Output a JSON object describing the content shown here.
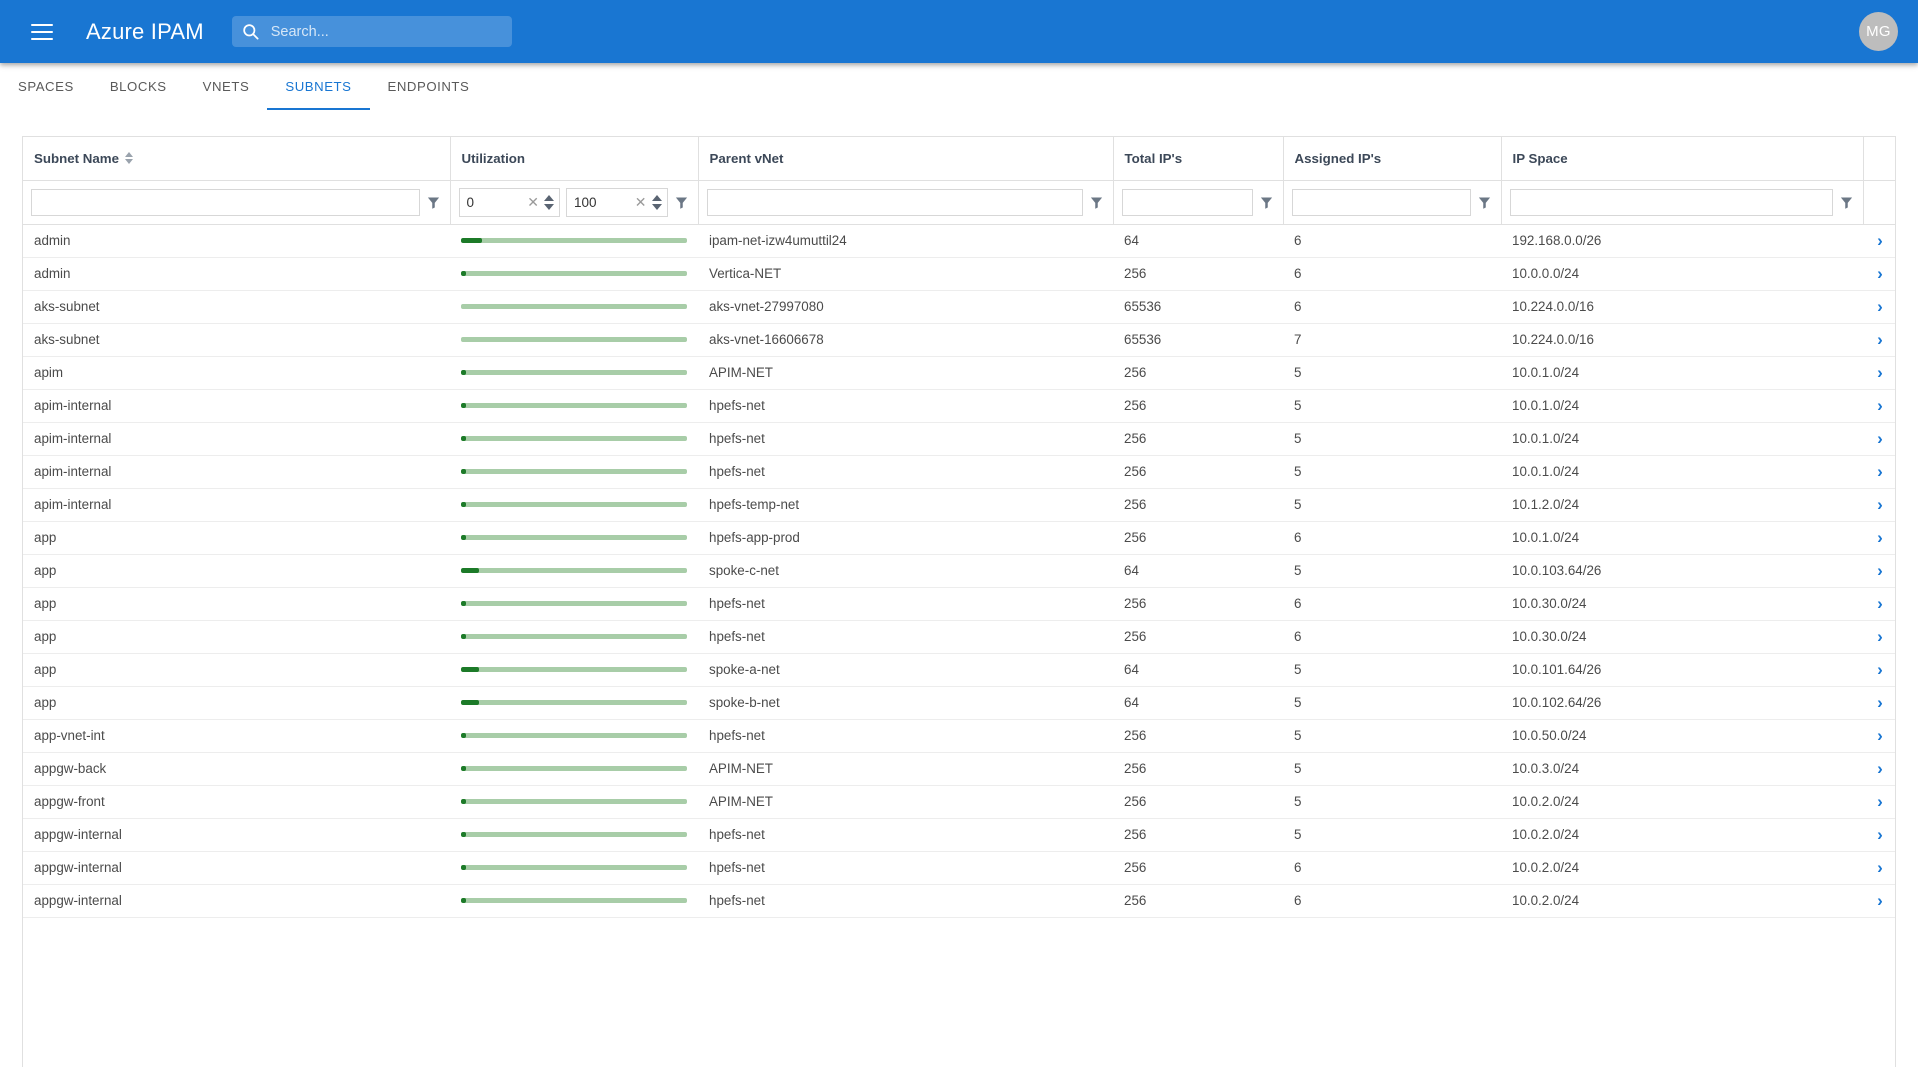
{
  "appbar": {
    "menu_icon": "hamburger-menu-icon",
    "title": "Azure IPAM",
    "search": {
      "icon": "search-icon",
      "value": "",
      "placeholder": "Search..."
    },
    "avatar_initials": "MG",
    "background_color": "#1976d2"
  },
  "tabs": [
    {
      "label": "SPACES",
      "active": false
    },
    {
      "label": "BLOCKS",
      "active": false
    },
    {
      "label": "VNETS",
      "active": false
    },
    {
      "label": "SUBNETS",
      "active": true
    },
    {
      "label": "ENDPOINTS",
      "active": false
    }
  ],
  "table": {
    "columns": [
      {
        "key": "subnet_name",
        "label": "Subnet Name",
        "sortable": true,
        "sort_icon": "sort-both-icon"
      },
      {
        "key": "utilization",
        "label": "Utilization",
        "sortable": false
      },
      {
        "key": "parent_vnet",
        "label": "Parent vNet",
        "sortable": false
      },
      {
        "key": "total_ips",
        "label": "Total IP's",
        "sortable": false
      },
      {
        "key": "assigned_ips",
        "label": "Assigned IP's",
        "sortable": false
      },
      {
        "key": "ip_space",
        "label": "IP Space",
        "sortable": false
      },
      {
        "key": "expand",
        "label": "",
        "sortable": false
      }
    ],
    "filters": {
      "subnet_name": {
        "value": "",
        "placeholder": ""
      },
      "utilization_min": {
        "value": "0",
        "clear_icon": "clear-icon",
        "spinner_icon": "spinner-icon"
      },
      "utilization_max": {
        "value": "100",
        "clear_icon": "clear-icon",
        "spinner_icon": "spinner-icon"
      },
      "parent_vnet": {
        "value": "",
        "placeholder": ""
      },
      "total_ips": {
        "value": "",
        "placeholder": ""
      },
      "assigned_ips": {
        "value": "",
        "placeholder": ""
      },
      "ip_space": {
        "value": "",
        "placeholder": ""
      },
      "funnel_icon": "filter-funnel-icon"
    },
    "row_expand_icon": "chevron-right-icon",
    "bar_track_color": "#a8cda8",
    "bar_fill_color": "#1c7a28",
    "rows": [
      {
        "subnet_name": "admin",
        "utilization_pct": 9.4,
        "parent_vnet": "ipam-net-izw4umuttil24",
        "total_ips": "64",
        "assigned_ips": "6",
        "ip_space": "192.168.0.0/26"
      },
      {
        "subnet_name": "admin",
        "utilization_pct": 2.3,
        "parent_vnet": "Vertica-NET",
        "total_ips": "256",
        "assigned_ips": "6",
        "ip_space": "10.0.0.0/24"
      },
      {
        "subnet_name": "aks-subnet",
        "utilization_pct": 0.0,
        "parent_vnet": "aks-vnet-27997080",
        "total_ips": "65536",
        "assigned_ips": "6",
        "ip_space": "10.224.0.0/16"
      },
      {
        "subnet_name": "aks-subnet",
        "utilization_pct": 0.0,
        "parent_vnet": "aks-vnet-16606678",
        "total_ips": "65536",
        "assigned_ips": "7",
        "ip_space": "10.224.0.0/16"
      },
      {
        "subnet_name": "apim",
        "utilization_pct": 2.0,
        "parent_vnet": "APIM-NET",
        "total_ips": "256",
        "assigned_ips": "5",
        "ip_space": "10.0.1.0/24"
      },
      {
        "subnet_name": "apim-internal",
        "utilization_pct": 2.0,
        "parent_vnet": "hpefs-net",
        "total_ips": "256",
        "assigned_ips": "5",
        "ip_space": "10.0.1.0/24"
      },
      {
        "subnet_name": "apim-internal",
        "utilization_pct": 2.0,
        "parent_vnet": "hpefs-net",
        "total_ips": "256",
        "assigned_ips": "5",
        "ip_space": "10.0.1.0/24"
      },
      {
        "subnet_name": "apim-internal",
        "utilization_pct": 2.0,
        "parent_vnet": "hpefs-net",
        "total_ips": "256",
        "assigned_ips": "5",
        "ip_space": "10.0.1.0/24"
      },
      {
        "subnet_name": "apim-internal",
        "utilization_pct": 2.0,
        "parent_vnet": "hpefs-temp-net",
        "total_ips": "256",
        "assigned_ips": "5",
        "ip_space": "10.1.2.0/24"
      },
      {
        "subnet_name": "app",
        "utilization_pct": 2.3,
        "parent_vnet": "hpefs-app-prod",
        "total_ips": "256",
        "assigned_ips": "6",
        "ip_space": "10.0.1.0/24"
      },
      {
        "subnet_name": "app",
        "utilization_pct": 7.8,
        "parent_vnet": "spoke-c-net",
        "total_ips": "64",
        "assigned_ips": "5",
        "ip_space": "10.0.103.64/26"
      },
      {
        "subnet_name": "app",
        "utilization_pct": 2.3,
        "parent_vnet": "hpefs-net",
        "total_ips": "256",
        "assigned_ips": "6",
        "ip_space": "10.0.30.0/24"
      },
      {
        "subnet_name": "app",
        "utilization_pct": 2.3,
        "parent_vnet": "hpefs-net",
        "total_ips": "256",
        "assigned_ips": "6",
        "ip_space": "10.0.30.0/24"
      },
      {
        "subnet_name": "app",
        "utilization_pct": 7.8,
        "parent_vnet": "spoke-a-net",
        "total_ips": "64",
        "assigned_ips": "5",
        "ip_space": "10.0.101.64/26"
      },
      {
        "subnet_name": "app",
        "utilization_pct": 7.8,
        "parent_vnet": "spoke-b-net",
        "total_ips": "64",
        "assigned_ips": "5",
        "ip_space": "10.0.102.64/26"
      },
      {
        "subnet_name": "app-vnet-int",
        "utilization_pct": 2.0,
        "parent_vnet": "hpefs-net",
        "total_ips": "256",
        "assigned_ips": "5",
        "ip_space": "10.0.50.0/24"
      },
      {
        "subnet_name": "appgw-back",
        "utilization_pct": 2.0,
        "parent_vnet": "APIM-NET",
        "total_ips": "256",
        "assigned_ips": "5",
        "ip_space": "10.0.3.0/24"
      },
      {
        "subnet_name": "appgw-front",
        "utilization_pct": 2.0,
        "parent_vnet": "APIM-NET",
        "total_ips": "256",
        "assigned_ips": "5",
        "ip_space": "10.0.2.0/24"
      },
      {
        "subnet_name": "appgw-internal",
        "utilization_pct": 2.0,
        "parent_vnet": "hpefs-net",
        "total_ips": "256",
        "assigned_ips": "5",
        "ip_space": "10.0.2.0/24"
      },
      {
        "subnet_name": "appgw-internal",
        "utilization_pct": 2.3,
        "parent_vnet": "hpefs-net",
        "total_ips": "256",
        "assigned_ips": "6",
        "ip_space": "10.0.2.0/24"
      },
      {
        "subnet_name": "appgw-internal",
        "utilization_pct": 2.3,
        "parent_vnet": "hpefs-net",
        "total_ips": "256",
        "assigned_ips": "6",
        "ip_space": "10.0.2.0/24"
      }
    ]
  }
}
